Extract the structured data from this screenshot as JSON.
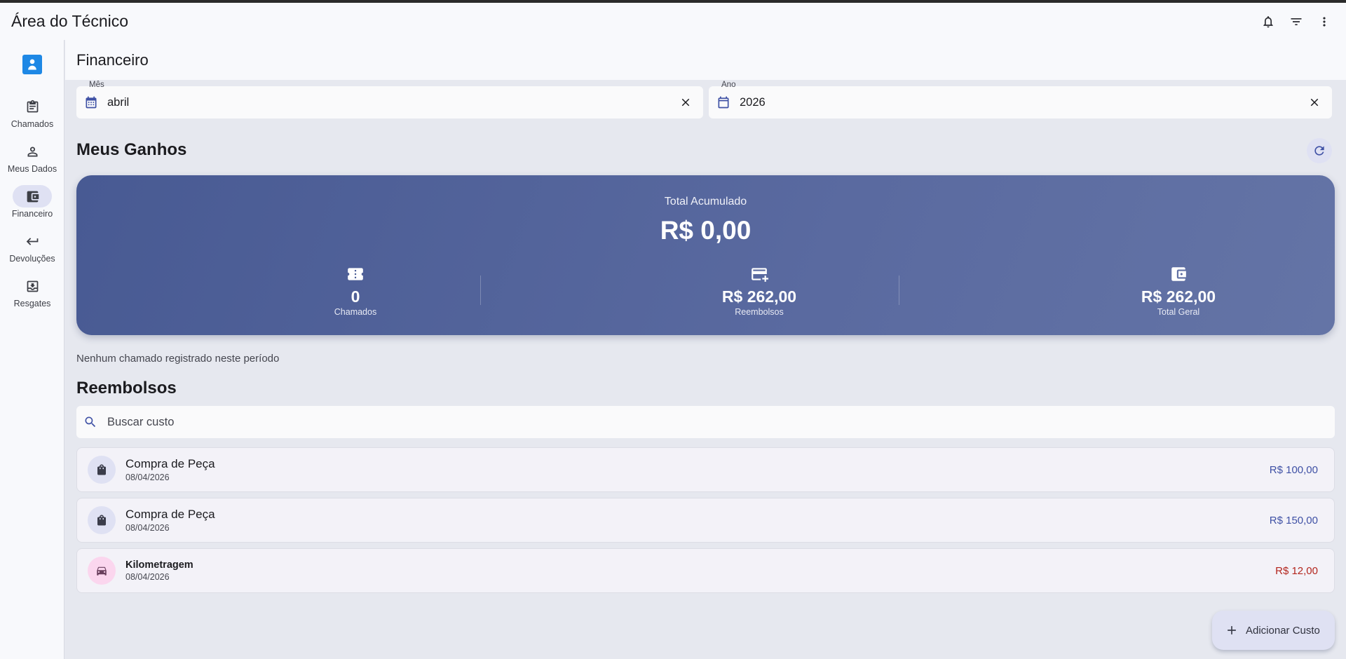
{
  "app": {
    "title": "Área do Técnico"
  },
  "appbar_icons": [
    "bell-icon",
    "filter-icon",
    "more-vert-icon"
  ],
  "sidebar": {
    "items": [
      {
        "label": "Chamados",
        "icon": "clipboard-icon",
        "active": false
      },
      {
        "label": "Meus Dados",
        "icon": "person-icon",
        "active": false
      },
      {
        "label": "Financeiro",
        "icon": "wallet-icon",
        "active": true
      },
      {
        "label": "Devoluções",
        "icon": "return-arrow-icon",
        "active": false
      },
      {
        "label": "Resgates",
        "icon": "download-box-icon",
        "active": false
      }
    ]
  },
  "page": {
    "title": "Financeiro"
  },
  "filters": {
    "month": {
      "label": "Mês",
      "value": "abril"
    },
    "year": {
      "label": "Ano",
      "value": "2026"
    }
  },
  "earnings": {
    "title": "Meus Ganhos",
    "total_label": "Total Acumulado",
    "total_value": "R$ 0,00",
    "stats": [
      {
        "value": "0",
        "label": "Chamados",
        "icon": "ticket-icon"
      },
      {
        "value": "R$ 262,00",
        "label": "Reembolsos",
        "icon": "card-plus-icon"
      },
      {
        "value": "R$ 262,00",
        "label": "Total Geral",
        "icon": "wallet-icon"
      }
    ],
    "empty_message": "Nenhum chamado registrado neste período"
  },
  "reimbursements": {
    "title": "Reembolsos",
    "search_placeholder": "Buscar custo",
    "items": [
      {
        "title": "Compra de Peça",
        "date": "08/04/2026",
        "amount": "R$ 100,00",
        "icon": "shopping-bag-icon",
        "amount_color": "#3f51a5"
      },
      {
        "title": "Compra de Peça",
        "date": "08/04/2026",
        "amount": "R$ 150,00",
        "icon": "shopping-bag-icon",
        "amount_color": "#3f51a5"
      },
      {
        "title": "Kilometragem",
        "date": "08/04/2026",
        "amount": "R$ 12,00",
        "icon": "car-icon",
        "amount_color": "#b3261e"
      }
    ]
  },
  "fab": {
    "label": "Adicionar Custo"
  }
}
